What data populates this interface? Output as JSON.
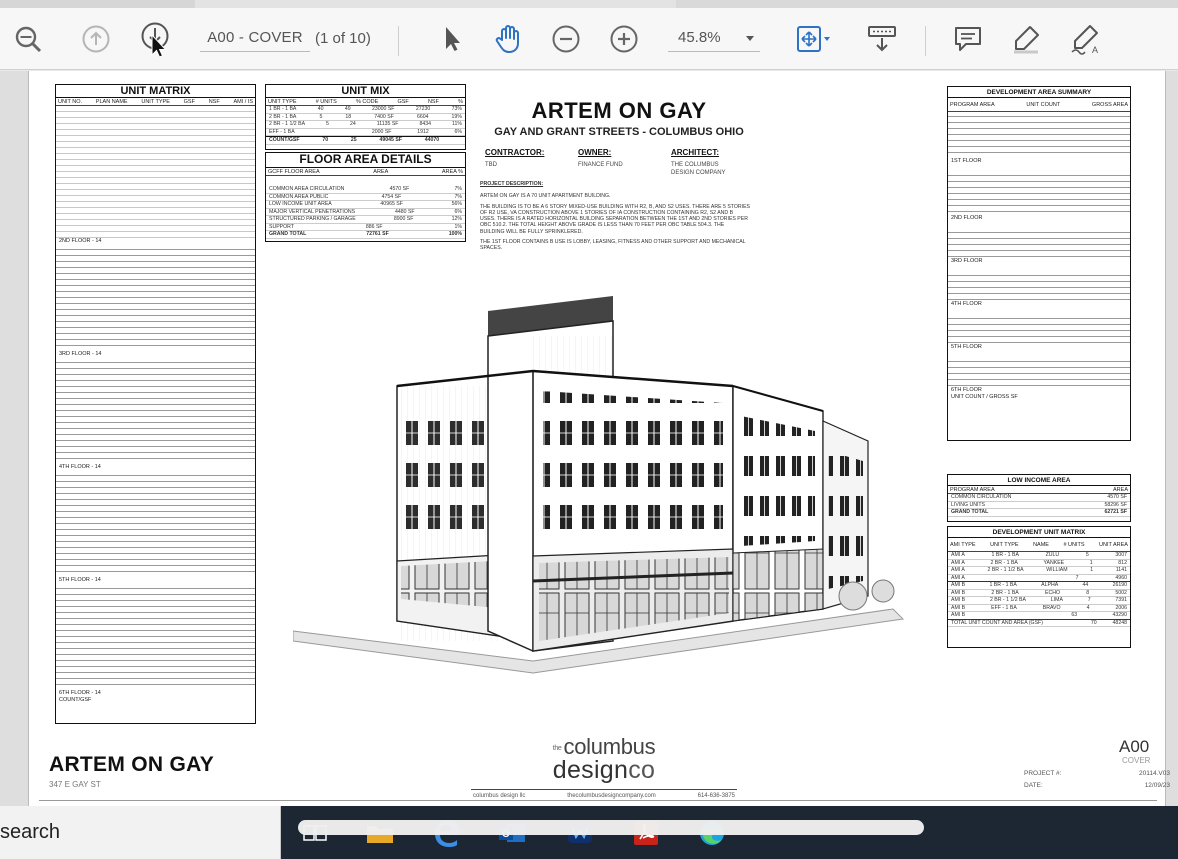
{
  "toolbar": {
    "page_label": "A00 - COVER",
    "page_count": "(1 of 10)",
    "zoom": "45.8%"
  },
  "sheet": {
    "unit_matrix_title": "UNIT MATRIX",
    "unit_matrix_cols": [
      "UNIT NO.",
      "PLAN NAME",
      "UNIT TYPE",
      "GSF",
      "NSF",
      "AMI / IS"
    ],
    "unit_matrix_sections": [
      "2ND FLOOR - 14",
      "3RD FLOOR - 14",
      "4TH FLOOR - 14",
      "5TH FLOOR - 14",
      "6TH FLOOR - 14"
    ],
    "unit_matrix_footer": "COUNT/GSF",
    "unit_mix_title": "UNIT MIX",
    "unit_mix_cols": [
      "UNIT TYPE",
      "# UNITS",
      "% CODE",
      "GSF",
      "NSF",
      "%"
    ],
    "unit_mix_rows": [
      [
        "1 BR - 1 BA",
        "40",
        "49",
        "23000 SF",
        "27230",
        "73%"
      ],
      [
        "2 BR - 1 BA",
        "5",
        "18",
        "7400 SF",
        "6604",
        "19%"
      ],
      [
        "2 BR - 1 1/2 BA",
        "5",
        "24",
        "11135 SF",
        "8434",
        "11%"
      ],
      [
        "EFF - 1 BA",
        "",
        "",
        "2000 SF",
        "1912",
        "6%"
      ],
      [
        "COUNT/GSF",
        "70",
        "25",
        "49045 SF",
        "44070",
        ""
      ]
    ],
    "floor_area_title": "FLOOR AREA DETAILS",
    "floor_area_cols": [
      "GCFF FLOOR AREA",
      "AREA",
      "AREA %"
    ],
    "floor_area_rows": [
      [
        "COMMON AREA CIRCULATION",
        "4570 SF",
        "7%"
      ],
      [
        "COMMON AREA PUBLIC",
        "4754 SF",
        "7%"
      ],
      [
        "LOW INCOME UNIT AREA",
        "40965 SF",
        "56%"
      ],
      [
        "MAJOR VERTICAL PENETRATIONS",
        "4480 SF",
        "6%"
      ],
      [
        "STRUCTURED PARKING / GARAGE",
        "8900 SF",
        "12%"
      ],
      [
        "SUPPORT",
        "886 SF",
        "1%"
      ],
      [
        "GRAND TOTAL",
        "72761 SF",
        "100%"
      ]
    ],
    "title": "ARTEM ON GAY",
    "subtitle": "GAY AND GRANT STREETS - COLUMBUS OHIO",
    "contractor_label": "CONTRACTOR:",
    "contractor": "TBD",
    "owner_label": "OWNER:",
    "owner": "FINANCE FUND",
    "architect_label": "ARCHITECT:",
    "architect_line1": "THE COLUMBUS",
    "architect_line2": "DESIGN COMPANY",
    "desc_heading": "PROJECT DESCRIPTION:",
    "desc_p1": "ARTEM ON GAY IS A 70 UNIT APARTMENT BUILDING.",
    "desc_p2": "THE BUILDING IS TO BE A 6 STORY MIXED-USE BUILDING WITH R2, B, AND S2 USES. THERE ARE 5 STORIES OF R2 USE, VA CONSTRUCTION ABOVE 1 STORIES OF IA CONSTRUCTION CONTAINING R2, S2 AND B USES. THERE IS A RATED HORIZONTAL BUILDING SEPARATION BETWEEN THE 1ST AND 2ND STORIES PER OBC 510.2. THE TOTAL HEIGHT ABOVE GRADE IS LESS THAN 70 FEET PER OBC TABLE 504.3. THE BUILDING WILL BE FULLY SPRINKLERED.",
    "desc_p3": "THE 1ST FLOOR CONTAINS B USE IS LOBBY, LEASING, FITNESS AND OTHER SUPPORT AND MECHANICAL SPACES.",
    "dev_area_title": "DEVELOPMENT AREA SUMMARY",
    "dev_area_cols": [
      "PROGRAM AREA",
      "UNIT COUNT",
      "GROSS AREA"
    ],
    "dev_area_floors": [
      "1ST FLOOR",
      "2ND FLOOR",
      "3RD FLOOR",
      "4TH FLOOR",
      "5TH FLOOR",
      "6TH FLOOR"
    ],
    "dev_area_total": "UNIT COUNT / GROSS SF",
    "low_income_title": "LOW INCOME AREA",
    "low_income_cols": [
      "PROGRAM AREA",
      "AREA"
    ],
    "low_income_rows": [
      [
        "COMMON CIRCULATION",
        "4570 SF"
      ],
      [
        "LIVING UNITS",
        "58296 SF"
      ],
      [
        "GRAND TOTAL",
        "62721 SF"
      ]
    ],
    "dev_unit_title": "DEVELOPMENT UNIT MATRIX",
    "dev_unit_cols": [
      "AMI TYPE",
      "UNIT TYPE",
      "NAME",
      "# UNITS",
      "UNIT AREA"
    ],
    "dev_unit_rows": [
      [
        "AMI A",
        "1 BR - 1 BA",
        "ZULU",
        "5",
        "3007"
      ],
      [
        "AMI A",
        "2 BR - 1 BA",
        "YANKEE",
        "1",
        "812"
      ],
      [
        "AMI A",
        "2 BR - 1 1/2 BA",
        "WILLIAM",
        "1",
        "1141"
      ],
      [
        "AMI A",
        "",
        "",
        "7",
        "4960"
      ],
      [
        "AMI B",
        "1 BR - 1 BA",
        "ALPHA",
        "44",
        "26190"
      ],
      [
        "AMI B",
        "2 BR - 1 BA",
        "ECHO",
        "8",
        "5002"
      ],
      [
        "AMI B",
        "2 BR - 1 1/2 BA",
        "LIMA",
        "7",
        "7391"
      ],
      [
        "AMI B",
        "EFF - 1 BA",
        "BRAVO",
        "4",
        "2006"
      ],
      [
        "AMI B",
        "",
        "",
        "63",
        "43290"
      ],
      [
        "TOTAL UNIT COUNT AND AREA (GSF)",
        "",
        "",
        "70",
        "48248"
      ]
    ],
    "bottom_title": "ARTEM ON GAY",
    "bottom_address": "347 E GAY ST",
    "logo_small": "the",
    "logo_line1": "columbus",
    "logo_line2a": "design",
    "logo_line2b": "co",
    "logo_foot": [
      "columbus design llc",
      "thecolumbusdesigncompany.com",
      "614-636-3875"
    ],
    "sheet_number": "A00",
    "sheet_name": "COVER",
    "project_label": "PROJECT #:",
    "project_value": "20114.V03",
    "date_label": "DATE:",
    "date_value": "12/09/23"
  },
  "taskbar": {
    "search_text": "search"
  },
  "colors": {
    "toolbar_icon": "#6b6b6b",
    "selected_icon": "#2d72c4",
    "taskbar_bg": "#1d2733"
  }
}
